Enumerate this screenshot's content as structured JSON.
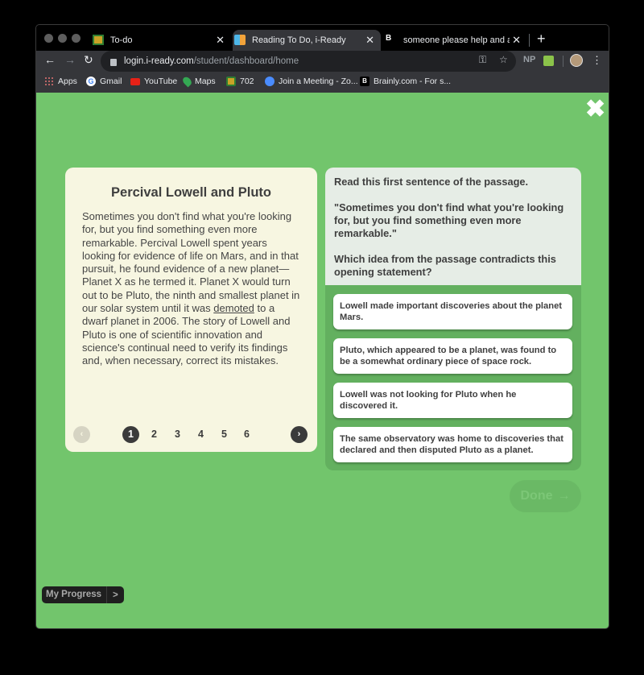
{
  "browser": {
    "tabs": [
      {
        "label": "To-do",
        "icon": "google-classroom-icon",
        "active": false
      },
      {
        "label": "Reading To Do, i-Ready",
        "icon": "iready-icon",
        "active": true
      },
      {
        "label": "someone please help and answe",
        "icon": "brainly-icon",
        "active": false
      }
    ],
    "new_tab": "+",
    "close_glyph": "✕",
    "url_host": "login.i-ready.com",
    "url_path": "/student/dashboard/home",
    "extension_np": "NP",
    "bookmarks": [
      {
        "label": "Apps",
        "icon": "apps-grid-icon"
      },
      {
        "label": "Gmail",
        "icon": "google-icon"
      },
      {
        "label": "YouTube",
        "icon": "youtube-icon"
      },
      {
        "label": "Maps",
        "icon": "maps-pin-icon"
      },
      {
        "label": "702",
        "icon": "google-classroom-icon"
      },
      {
        "label": "Join a Meeting - Zo...",
        "icon": "zoom-icon"
      },
      {
        "label": "Brainly.com - For s...",
        "icon": "brainly-icon"
      }
    ]
  },
  "lesson": {
    "close_glyph": "✖",
    "passage": {
      "title": "Percival Lowell and Pluto",
      "text_before": "Sometimes you don't find what you're looking for, but you find something even more remarkable. Percival Lowell spent years looking for evidence of life on Mars, and in that pursuit, he found evidence of a new planet—Planet X as he termed it. Planet X would turn out to be Pluto, the ninth and smallest planet in our solar system until it was ",
      "underlined_word": "demoted",
      "text_after": " to a dwarf planet in 2006. The story of Lowell and Pluto is one of scientific innovation and science's continual need to verify its findings and, when necessary, correct its mistakes.",
      "pages": [
        "1",
        "2",
        "3",
        "4",
        "5",
        "6"
      ],
      "current_page": 1,
      "prev_glyph": "‹",
      "next_glyph": "›"
    },
    "question": {
      "intro": "Read this first sentence of the passage.",
      "quote": "\"Sometimes you don't find what you're looking for, but you find something even more remarkable.\"",
      "prompt": "Which idea from the passage contradicts this opening statement?",
      "choices": [
        "Lowell made important discoveries about the planet Mars.",
        "Pluto, which appeared to be a planet, was found to be a somewhat ordinary piece of space rock.",
        "Lowell was not looking for Pluto when he discovered it.",
        "The same observatory was home to discoveries that declared and then disputed Pluto as a planet."
      ]
    },
    "done_label": "Done",
    "done_arrow": "→",
    "my_progress_label": "My Progress",
    "my_progress_arrow": ">"
  }
}
